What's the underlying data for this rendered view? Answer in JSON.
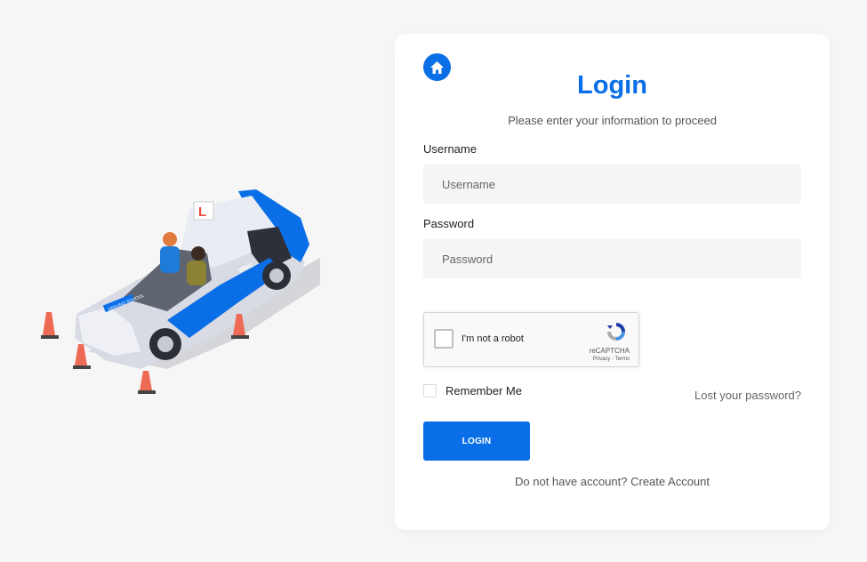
{
  "colors": {
    "accent": "#0a6ee6",
    "page_bg": "#f6f6f6",
    "card_bg": "#ffffff"
  },
  "illustration": {
    "car_plate_text": "DRIVING SCHOOL",
    "door_text": "VING",
    "roof_sign": "L"
  },
  "login": {
    "home_icon": "home-icon",
    "title": "Login",
    "subtitle": "Please enter your information to proceed",
    "username_label": "Username",
    "username_placeholder": "Username",
    "username_value": "",
    "password_label": "Password",
    "password_placeholder": "Password",
    "password_value": "",
    "captcha_text": "I'm not a robot",
    "captcha_brand": "reCAPTCHA",
    "captcha_links": "Privacy - Terms",
    "remember_label": "Remember Me",
    "lost_password": "Lost your password?",
    "login_button": "LOGIN",
    "no_account_text": "Do not have account?",
    "create_account": "Create Account"
  }
}
